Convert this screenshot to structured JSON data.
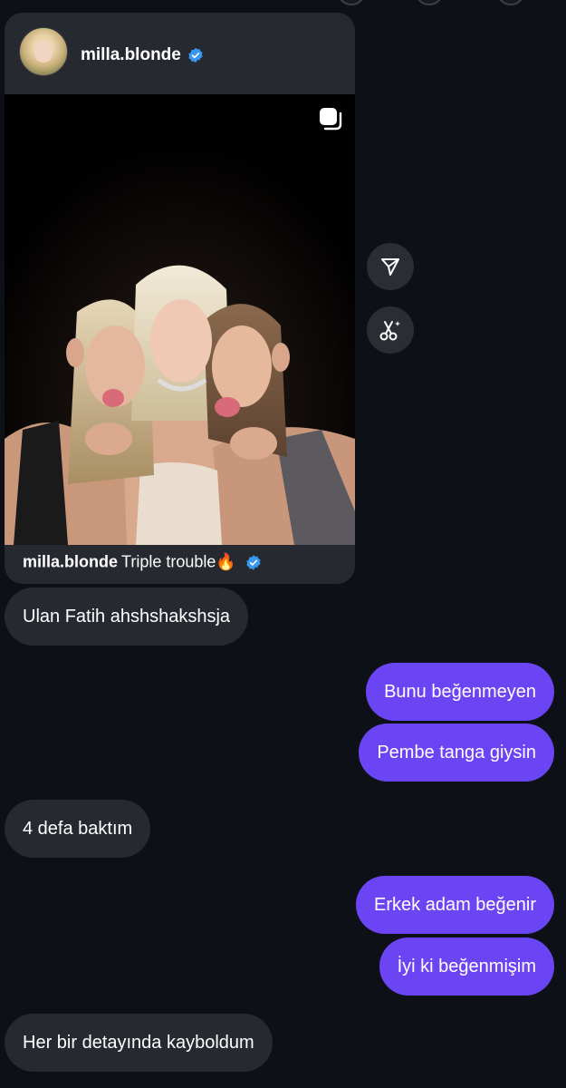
{
  "shared_post": {
    "username": "milla.blonde",
    "verified_icon": "verified-badge-icon",
    "caption_user": "milla.blonde",
    "caption_text": "Triple trouble",
    "caption_emoji": "🔥",
    "carousel_icon": "multiple-media-icon"
  },
  "actions": {
    "share_icon": "send-paper-plane-icon",
    "remix_icon": "scissors-sparkle-icon"
  },
  "messages": [
    {
      "side": "received",
      "text": "Ulan Fatih ahshshakshsja"
    },
    {
      "side": "sent",
      "text": "Bunu beğenmeyen"
    },
    {
      "side": "sent",
      "text": "Pembe tanga giysin"
    },
    {
      "side": "received",
      "text": "4 defa baktım"
    },
    {
      "side": "sent",
      "text": "Erkek adam beğenir"
    },
    {
      "side": "sent",
      "text": "İyi ki beğenmişim"
    },
    {
      "side": "received",
      "text": "Her bir detayında kayboldum"
    }
  ],
  "colors": {
    "background": "#0d1016",
    "received_bubble": "#262930",
    "sent_bubble": "#6b45f3",
    "verified": "#3897f0"
  }
}
